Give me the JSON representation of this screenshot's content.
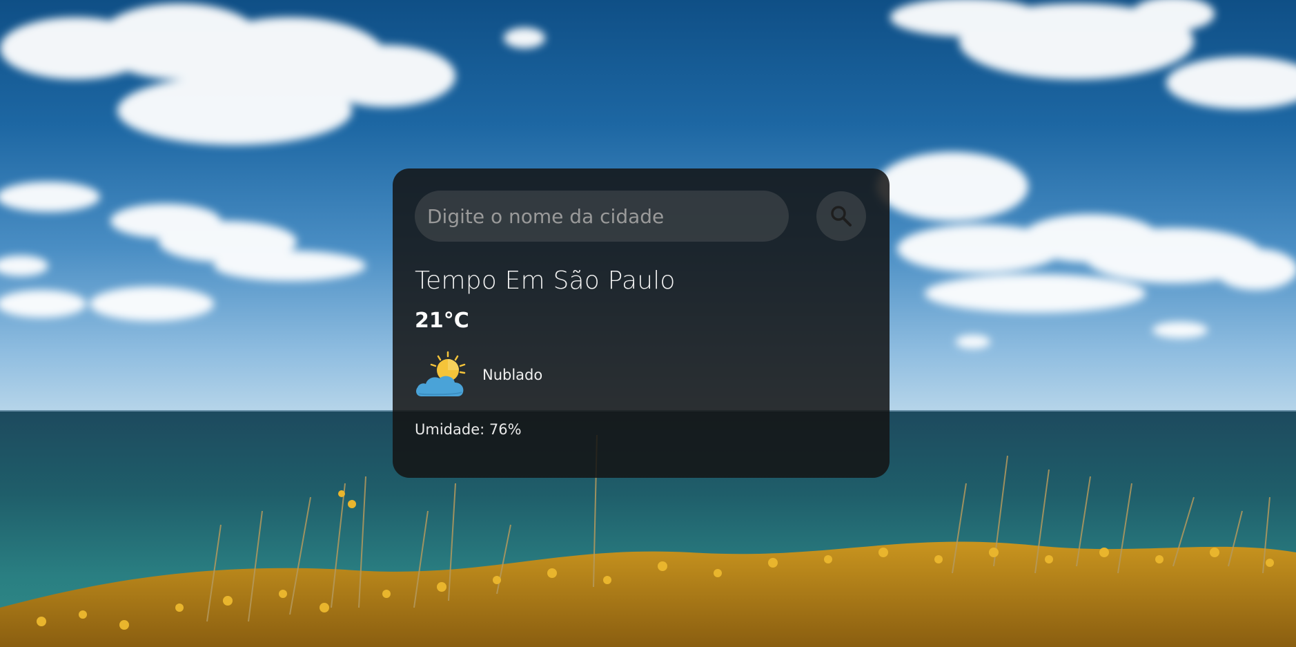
{
  "search": {
    "placeholder": "Digite o nome da cidade",
    "value": ""
  },
  "weather": {
    "title": "Tempo Em São Paulo",
    "temperature": "21°C",
    "condition": "Nublado",
    "humidity": "Umidade: 76%"
  },
  "icons": {
    "search": "search-icon",
    "weather": "partly-cloudy-icon"
  },
  "colors": {
    "card_background": "#141414",
    "sun": "#f5c43a",
    "cloud": "#4aa3d8"
  }
}
